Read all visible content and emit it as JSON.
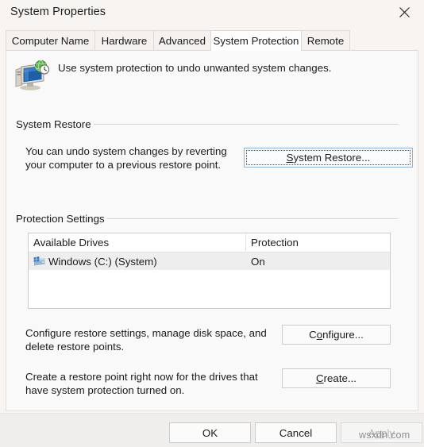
{
  "window": {
    "title": "System Properties",
    "close_icon": "close-icon"
  },
  "tabs": [
    {
      "label": "Computer Name",
      "selected": false
    },
    {
      "label": "Hardware",
      "selected": false
    },
    {
      "label": "Advanced",
      "selected": false
    },
    {
      "label": "System Protection",
      "selected": true
    },
    {
      "label": "Remote",
      "selected": false
    }
  ],
  "intro": {
    "icon": "system-restore-icon",
    "text": "Use system protection to undo unwanted system changes."
  },
  "system_restore": {
    "group_label": "System Restore",
    "description_line1": "You can undo system changes by reverting",
    "description_line2": "your computer to a previous restore point.",
    "button": {
      "label_before": "S",
      "label_accel": "S",
      "label_rest": "ystem Restore...",
      "full_label": "System Restore...",
      "focused": true
    }
  },
  "protection_settings": {
    "group_label": "Protection Settings",
    "columns": [
      "Available Drives",
      "Protection"
    ],
    "rows": [
      {
        "icon": "hard-drive-windows-icon",
        "drive": "Windows (C:) (System)",
        "protection": "On",
        "selected": true
      }
    ],
    "configure": {
      "description_line1": "Configure restore settings, manage disk space, and",
      "description_line2": "delete restore points.",
      "button_accel_before": "C",
      "button_accel": "o",
      "button_accel_after": "nfigure...",
      "full_label": "Configure..."
    },
    "create": {
      "description_line1": "Create a restore point right now for the drives that",
      "description_line2": "have system protection turned on.",
      "button_accel": "C",
      "button_accel_after": "reate...",
      "full_label": "Create..."
    }
  },
  "footer": {
    "ok_label": "OK",
    "cancel_label": "Cancel",
    "apply_label": "Apply",
    "apply_disabled": true,
    "watermark": "wsxdn.com"
  },
  "colors": {
    "title_bar": "#f8f4f1",
    "panel": "#f9f9f9",
    "footer": "#f0eeec",
    "default_button_border": "#8ab5d8",
    "row_selected": "#eeeeee",
    "text": "#1b1b1b",
    "disabled_text": "#b7b7b7"
  }
}
